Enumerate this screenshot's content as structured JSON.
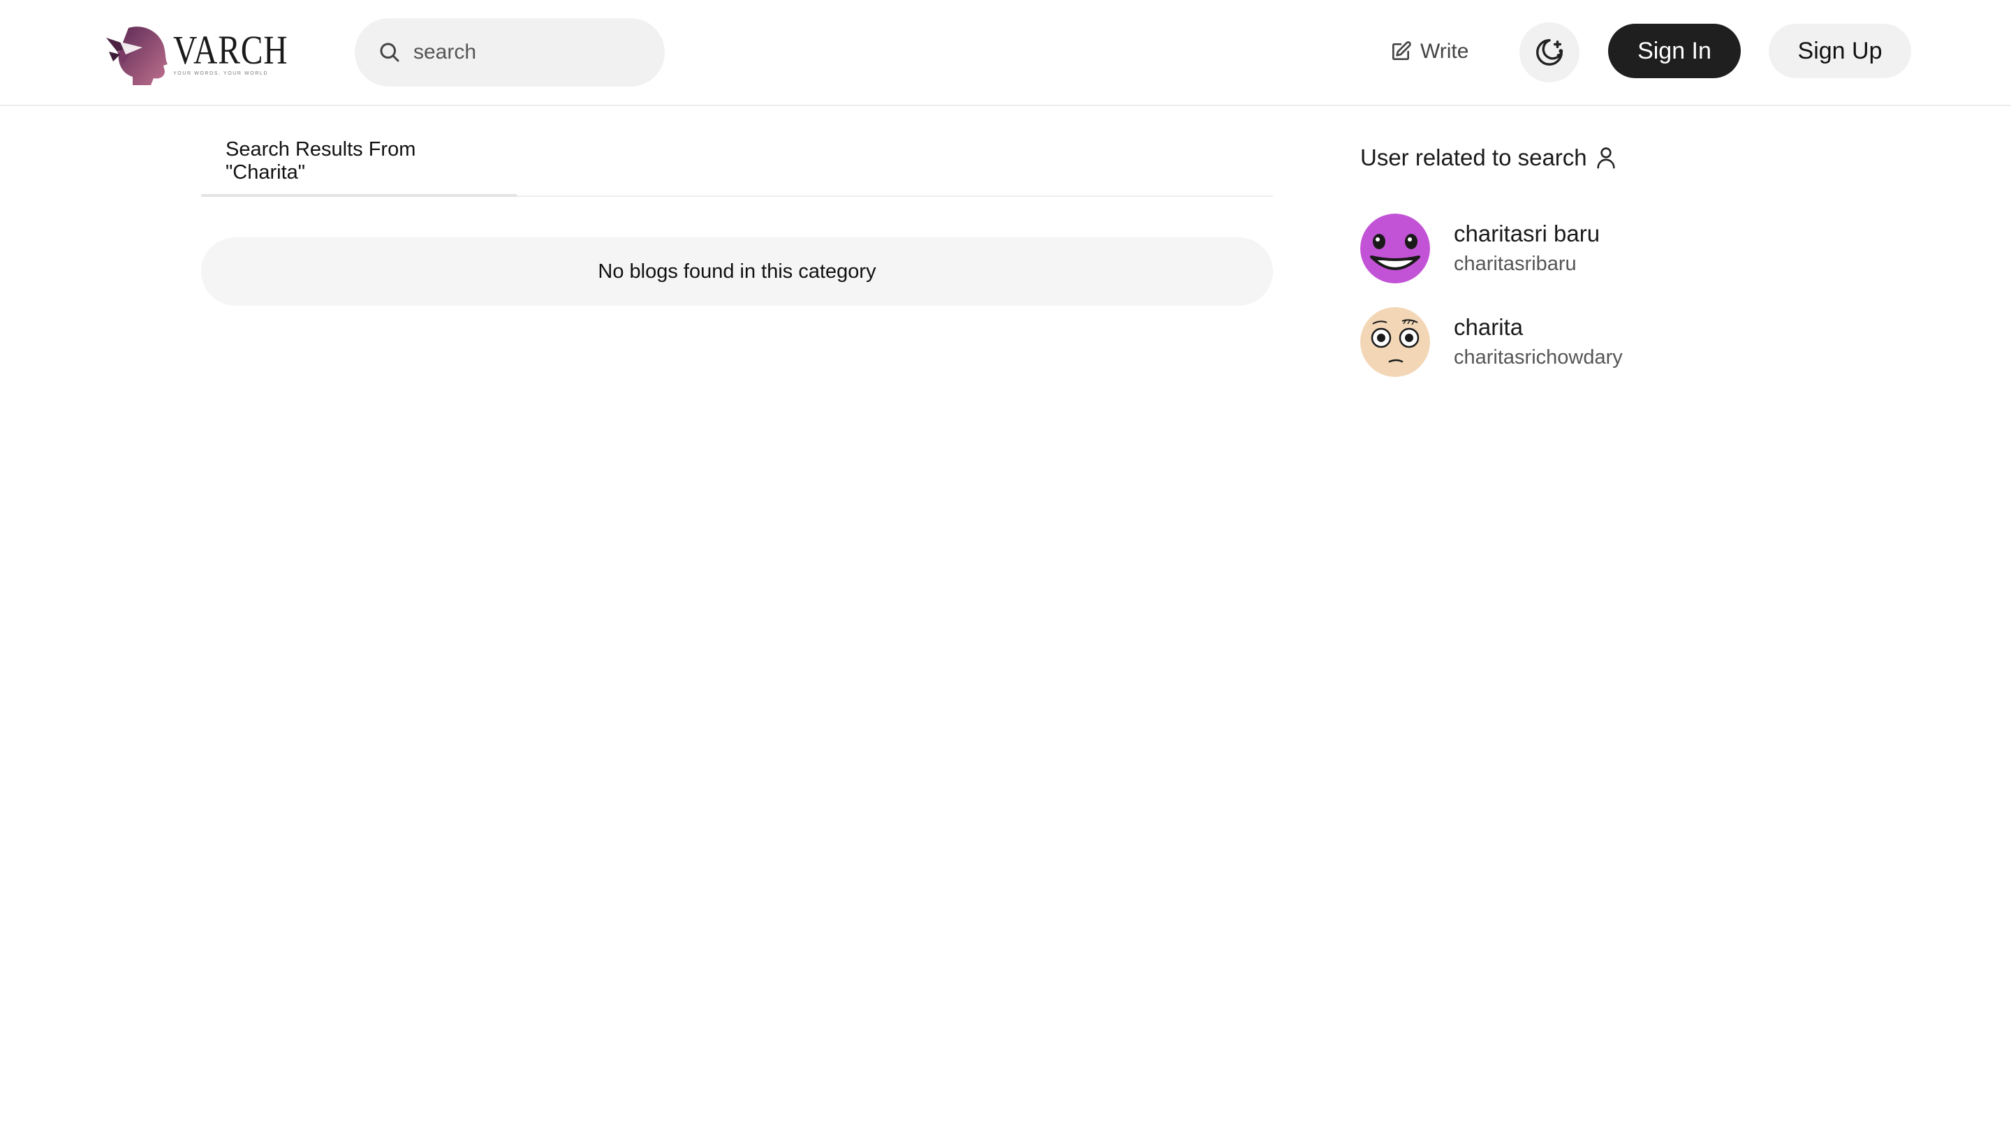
{
  "navbar": {
    "logo": {
      "name": "VARCH",
      "tagline": "YOUR WORDS, YOUR WORLD",
      "color": "#9b4a7a"
    },
    "search": {
      "placeholder": "search",
      "value": ""
    },
    "write_label": "Write",
    "theme_toggle_icon": "moon-sparkle-icon",
    "signin_label": "Sign In",
    "signup_label": "Sign Up"
  },
  "main": {
    "tab_label": "Search Results From \"Charita\"",
    "empty_message": "No blogs found in this category"
  },
  "sidebar": {
    "heading": "User related to search",
    "heading_icon": "user-icon",
    "users": [
      {
        "fullname": "charitasri baru",
        "username": "charitasribaru",
        "avatar_color": "#c353d6",
        "avatar_icon": "grinning-face-avatar"
      },
      {
        "fullname": "charita",
        "username": "charitasrichowdary",
        "avatar_color": "#f2d6b6",
        "avatar_icon": "confused-face-avatar"
      }
    ]
  }
}
